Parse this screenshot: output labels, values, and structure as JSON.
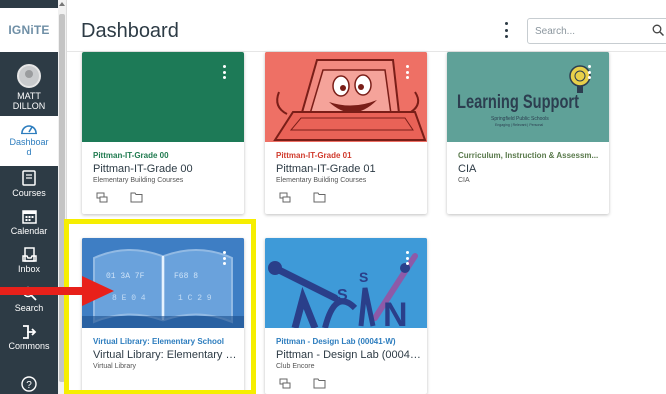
{
  "nav": {
    "logo": "IGNiTE",
    "account_label": "MATT DILLON",
    "items": [
      {
        "label": "Dashboard",
        "icon": "dashboard-icon"
      },
      {
        "label": "Courses",
        "icon": "courses-icon"
      },
      {
        "label": "Calendar",
        "icon": "calendar-icon"
      },
      {
        "label": "Inbox",
        "icon": "inbox-icon"
      },
      {
        "label": "Search",
        "icon": "search-icon"
      },
      {
        "label": "Commons",
        "icon": "commons-icon"
      },
      {
        "label": "Help",
        "icon": "help-icon"
      }
    ]
  },
  "header": {
    "title": "Dashboard",
    "search_placeholder": "Search..."
  },
  "cards": [
    {
      "short": "Pittman-IT-Grade 00",
      "title": "Pittman-IT-Grade 00",
      "term": "Elementary Building Courses",
      "short_color": "#1f7a4f",
      "hero_color": "#1d7a57",
      "image": "solid-green"
    },
    {
      "short": "Pittman-IT-Grade 01",
      "title": "Pittman-IT-Grade 01",
      "term": "Elementary Building Courses",
      "short_color": "#d03a2c",
      "hero_color": "#ee7065",
      "image": "laptop-cartoon"
    },
    {
      "short": "Curriculum, Instruction & Assessm...",
      "title": "CIA",
      "term": "CIA",
      "short_color": "#5a7a4c",
      "hero_color": "#5fa198",
      "image": "learning-support-logo"
    },
    {
      "short": "Virtual Library: Elementary School",
      "title": "Virtual Library: Elementary Sc...",
      "term": "Virtual Library",
      "short_color": "#2d7dbe",
      "hero_color": "#2b6bb0",
      "image": "digital-book"
    },
    {
      "short": "Pittman - Design Lab (00041-W)",
      "title": "Pittman - Design Lab (00041-W)",
      "term": "Club Encore",
      "short_color": "#2d7dbe",
      "hero_color": "#3e9ad8",
      "image": "tools-letters"
    }
  ],
  "hero_images": {
    "learning_support_title": "Learning Support",
    "learning_support_subtitle": "Springfield Public Schools",
    "learning_support_tagline": "Engaging | Relevant | Personal"
  },
  "annotation": {
    "highlight_color": "#f6ee00",
    "arrow_color": "#e8201a"
  }
}
